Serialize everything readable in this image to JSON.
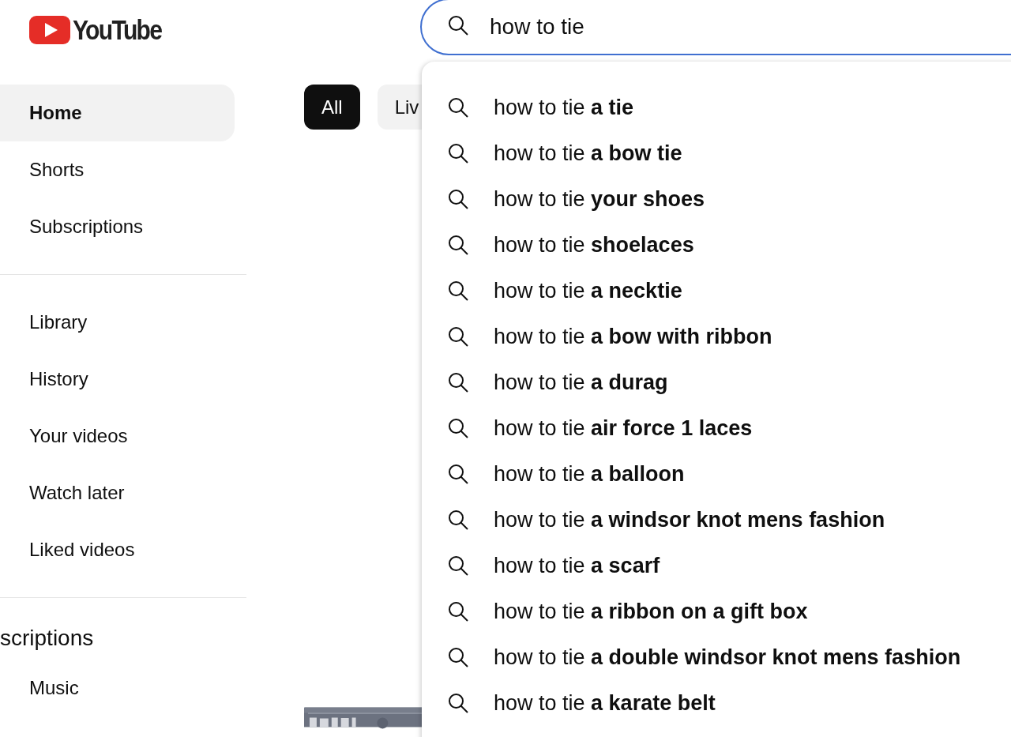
{
  "logo": {
    "text": "YouTube"
  },
  "search": {
    "value": "how to tie"
  },
  "sidebar": {
    "sections": [
      {
        "items": [
          {
            "label": "Home",
            "selected": true
          },
          {
            "label": "Shorts",
            "selected": false
          },
          {
            "label": "Subscriptions",
            "selected": false
          }
        ]
      },
      {
        "items": [
          {
            "label": "Library",
            "selected": false
          },
          {
            "label": "History",
            "selected": false
          },
          {
            "label": "Your videos",
            "selected": false
          },
          {
            "label": "Watch later",
            "selected": false
          },
          {
            "label": "Liked videos",
            "selected": false
          }
        ]
      },
      {
        "heading": "scriptions",
        "items": [
          {
            "label": "Music",
            "selected": false
          }
        ]
      }
    ]
  },
  "chips": [
    {
      "label": "All",
      "selected": true
    },
    {
      "label": "Liv",
      "selected": false
    }
  ],
  "suggestions": [
    "how to tie **a tie**",
    "how to tie **a bow tie**",
    "how to tie **your shoes**",
    "how to tie **shoelaces**",
    "how to tie **a necktie**",
    "how to tie **a bow with ribbon**",
    "how to tie **a durag**",
    "how to tie **air force 1 laces**",
    "how to tie **a balloon**",
    "how to tie **a windsor knot mens fashion**",
    "how to tie **a scarf**",
    "how to tie **a ribbon on a gift box**",
    "how to tie **a double windsor knot mens fashion**",
    "how to tie **a karate belt**"
  ]
}
